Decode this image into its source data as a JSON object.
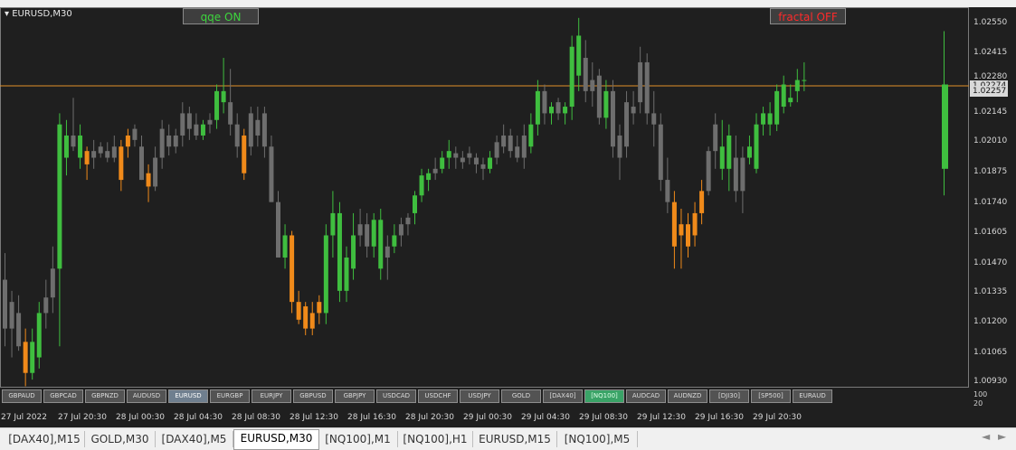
{
  "window": {
    "title": "EURUSD,M30"
  },
  "toggles": {
    "qqe": "qqe ON",
    "fractal": "fractal OFF"
  },
  "colors": {
    "up": "#3fbe3f",
    "down": "#f08a1a",
    "neutral": "#6e6e6e",
    "price_line": "#e0902a",
    "qqe_text": "#3dd63d",
    "fractal_text": "#ff2a2a"
  },
  "price_axis": {
    "labels": [
      "1.02550",
      "1.02415",
      "1.02280",
      "1.02145",
      "1.02010",
      "1.01875",
      "1.01740",
      "1.01605",
      "1.01470",
      "1.01335",
      "1.01200",
      "1.01065",
      "1.00930"
    ],
    "current_price": "1.02257",
    "line_price": "1.02274"
  },
  "indicator_axis": {
    "labels": [
      "100",
      "20"
    ]
  },
  "time_axis": [
    "27 Jul 2022",
    "27 Jul 20:30",
    "28 Jul 00:30",
    "28 Jul 04:30",
    "28 Jul 08:30",
    "28 Jul 12:30",
    "28 Jul 16:30",
    "28 Jul 20:30",
    "29 Jul 00:30",
    "29 Jul 04:30",
    "29 Jul 08:30",
    "29 Jul 12:30",
    "29 Jul 16:30",
    "29 Jul 20:30"
  ],
  "symbol_buttons": [
    "GBPAUD",
    "GBPCAD",
    "GBPNZD",
    "AUDUSD",
    "EURUSD",
    "EURGBP",
    "EURJPY",
    "GBPUSD",
    "GBPJPY",
    "USDCAD",
    "USDCHF",
    "USDJPY",
    "GOLD",
    "[DAX40]",
    "[NQ100]",
    "AUDCAD",
    "AUDNZD",
    "[DJI30]",
    "[SP500]",
    "EURAUD"
  ],
  "active_symbol": "EURUSD",
  "highlight_symbol": "[NQ100]",
  "tabs": [
    "[DAX40],M15",
    "GOLD,M30",
    "[DAX40],M5",
    "EURUSD,M30",
    "[NQ100],M1",
    "[NQ100],H1",
    "EURUSD,M15",
    "[NQ100],M5"
  ],
  "active_tab": "EURUSD,M30",
  "tab_nav": {
    "left": "◄",
    "right": "►"
  },
  "chart_data": {
    "type": "candlestick",
    "symbol": "EURUSD",
    "timeframe": "M30",
    "ylim": [
      1.0093,
      1.0262
    ],
    "candles": [
      {
        "o": 1.014,
        "h": 1.0152,
        "l": 1.011,
        "c": 1.0118,
        "k": "n"
      },
      {
        "o": 1.0118,
        "h": 1.0135,
        "l": 1.0105,
        "c": 1.013,
        "k": "n"
      },
      {
        "o": 1.0125,
        "h": 1.0133,
        "l": 1.0108,
        "c": 1.011,
        "k": "n"
      },
      {
        "o": 1.0112,
        "h": 1.0118,
        "l": 1.0092,
        "c": 1.0098,
        "k": "d"
      },
      {
        "o": 1.0098,
        "h": 1.0118,
        "l": 1.0095,
        "c": 1.0112,
        "k": "u"
      },
      {
        "o": 1.0105,
        "h": 1.013,
        "l": 1.01,
        "c": 1.0125,
        "k": "u"
      },
      {
        "o": 1.0125,
        "h": 1.014,
        "l": 1.0118,
        "c": 1.0132,
        "k": "n"
      },
      {
        "o": 1.0132,
        "h": 1.0155,
        "l": 1.0125,
        "c": 1.0145,
        "k": "n"
      },
      {
        "o": 1.0145,
        "h": 1.0215,
        "l": 1.011,
        "c": 1.021,
        "k": "u"
      },
      {
        "o": 1.0195,
        "h": 1.0212,
        "l": 1.0187,
        "c": 1.0205,
        "k": "u"
      },
      {
        "o": 1.0205,
        "h": 1.0222,
        "l": 1.0198,
        "c": 1.02,
        "k": "n"
      },
      {
        "o": 1.0205,
        "h": 1.021,
        "l": 1.019,
        "c": 1.0195,
        "k": "u"
      },
      {
        "o": 1.0198,
        "h": 1.02,
        "l": 1.0185,
        "c": 1.0192,
        "k": "d"
      },
      {
        "o": 1.0198,
        "h": 1.0203,
        "l": 1.019,
        "c": 1.0195,
        "k": "n"
      },
      {
        "o": 1.02,
        "h": 1.0202,
        "l": 1.0195,
        "c": 1.0197,
        "k": "n"
      },
      {
        "o": 1.0198,
        "h": 1.0202,
        "l": 1.0193,
        "c": 1.0195,
        "k": "n"
      },
      {
        "o": 1.02,
        "h": 1.0205,
        "l": 1.0193,
        "c": 1.0195,
        "k": "n"
      },
      {
        "o": 1.02,
        "h": 1.0203,
        "l": 1.018,
        "c": 1.0185,
        "k": "d"
      },
      {
        "o": 1.02,
        "h": 1.0208,
        "l": 1.0195,
        "c": 1.0205,
        "k": "d"
      },
      {
        "o": 1.0208,
        "h": 1.021,
        "l": 1.02,
        "c": 1.0203,
        "k": "n"
      },
      {
        "o": 1.02,
        "h": 1.0205,
        "l": 1.0185,
        "c": 1.0185,
        "k": "n"
      },
      {
        "o": 1.0188,
        "h": 1.0192,
        "l": 1.0175,
        "c": 1.0182,
        "k": "d"
      },
      {
        "o": 1.0182,
        "h": 1.02,
        "l": 1.018,
        "c": 1.0195,
        "k": "n"
      },
      {
        "o": 1.0195,
        "h": 1.0212,
        "l": 1.019,
        "c": 1.0208,
        "k": "n"
      },
      {
        "o": 1.0205,
        "h": 1.021,
        "l": 1.0196,
        "c": 1.02,
        "k": "n"
      },
      {
        "o": 1.02,
        "h": 1.0208,
        "l": 1.0197,
        "c": 1.0205,
        "k": "n"
      },
      {
        "o": 1.0205,
        "h": 1.022,
        "l": 1.02,
        "c": 1.0215,
        "k": "n"
      },
      {
        "o": 1.0215,
        "h": 1.0218,
        "l": 1.0203,
        "c": 1.0208,
        "k": "n"
      },
      {
        "o": 1.021,
        "h": 1.0215,
        "l": 1.0203,
        "c": 1.0205,
        "k": "n"
      },
      {
        "o": 1.0205,
        "h": 1.0212,
        "l": 1.0203,
        "c": 1.021,
        "k": "u"
      },
      {
        "o": 1.021,
        "h": 1.0215,
        "l": 1.0206,
        "c": 1.0212,
        "k": "n"
      },
      {
        "o": 1.0212,
        "h": 1.0228,
        "l": 1.0208,
        "c": 1.0225,
        "k": "u"
      },
      {
        "o": 1.0225,
        "h": 1.024,
        "l": 1.0215,
        "c": 1.022,
        "k": "u"
      },
      {
        "o": 1.022,
        "h": 1.0235,
        "l": 1.0205,
        "c": 1.021,
        "k": "n"
      },
      {
        "o": 1.021,
        "h": 1.0215,
        "l": 1.0195,
        "c": 1.02,
        "k": "n"
      },
      {
        "o": 1.0205,
        "h": 1.0208,
        "l": 1.0185,
        "c": 1.0188,
        "k": "d"
      },
      {
        "o": 1.02,
        "h": 1.0218,
        "l": 1.0196,
        "c": 1.0215,
        "k": "n"
      },
      {
        "o": 1.0212,
        "h": 1.0218,
        "l": 1.02,
        "c": 1.0205,
        "k": "n"
      },
      {
        "o": 1.0215,
        "h": 1.0218,
        "l": 1.0195,
        "c": 1.02,
        "k": "n"
      },
      {
        "o": 1.02,
        "h": 1.0205,
        "l": 1.0175,
        "c": 1.0175,
        "k": "n"
      },
      {
        "o": 1.0175,
        "h": 1.018,
        "l": 1.015,
        "c": 1.015,
        "k": "n"
      },
      {
        "o": 1.015,
        "h": 1.0165,
        "l": 1.0145,
        "c": 1.016,
        "k": "u"
      },
      {
        "o": 1.016,
        "h": 1.0162,
        "l": 1.0125,
        "c": 1.013,
        "k": "d"
      },
      {
        "o": 1.013,
        "h": 1.0135,
        "l": 1.012,
        "c": 1.0122,
        "k": "d"
      },
      {
        "o": 1.0128,
        "h": 1.013,
        "l": 1.0115,
        "c": 1.0118,
        "k": "d"
      },
      {
        "o": 1.0125,
        "h": 1.013,
        "l": 1.0115,
        "c": 1.0118,
        "k": "d"
      },
      {
        "o": 1.013,
        "h": 1.0133,
        "l": 1.012,
        "c": 1.0125,
        "k": "d"
      },
      {
        "o": 1.0125,
        "h": 1.0165,
        "l": 1.012,
        "c": 1.016,
        "k": "u"
      },
      {
        "o": 1.016,
        "h": 1.018,
        "l": 1.015,
        "c": 1.017,
        "k": "u"
      },
      {
        "o": 1.017,
        "h": 1.0175,
        "l": 1.013,
        "c": 1.0135,
        "k": "u"
      },
      {
        "o": 1.0135,
        "h": 1.0155,
        "l": 1.013,
        "c": 1.015,
        "k": "u"
      },
      {
        "o": 1.0145,
        "h": 1.017,
        "l": 1.014,
        "c": 1.016,
        "k": "u"
      },
      {
        "o": 1.016,
        "h": 1.0172,
        "l": 1.0155,
        "c": 1.0165,
        "k": "n"
      },
      {
        "o": 1.0165,
        "h": 1.017,
        "l": 1.015,
        "c": 1.0155,
        "k": "n"
      },
      {
        "o": 1.0155,
        "h": 1.017,
        "l": 1.015,
        "c": 1.0167,
        "k": "u"
      },
      {
        "o": 1.0167,
        "h": 1.0172,
        "l": 1.014,
        "c": 1.0145,
        "k": "u"
      },
      {
        "o": 1.0155,
        "h": 1.016,
        "l": 1.014,
        "c": 1.015,
        "k": "n"
      },
      {
        "o": 1.0155,
        "h": 1.0165,
        "l": 1.0152,
        "c": 1.016,
        "k": "u"
      },
      {
        "o": 1.016,
        "h": 1.0168,
        "l": 1.0155,
        "c": 1.0165,
        "k": "n"
      },
      {
        "o": 1.0165,
        "h": 1.017,
        "l": 1.016,
        "c": 1.0168,
        "k": "n"
      },
      {
        "o": 1.017,
        "h": 1.018,
        "l": 1.0165,
        "c": 1.0178,
        "k": "u"
      },
      {
        "o": 1.0178,
        "h": 1.019,
        "l": 1.0175,
        "c": 1.0187,
        "k": "u"
      },
      {
        "o": 1.0185,
        "h": 1.019,
        "l": 1.018,
        "c": 1.0188,
        "k": "u"
      },
      {
        "o": 1.0188,
        "h": 1.0195,
        "l": 1.0185,
        "c": 1.019,
        "k": "n"
      },
      {
        "o": 1.019,
        "h": 1.0198,
        "l": 1.0188,
        "c": 1.0195,
        "k": "u"
      },
      {
        "o": 1.0195,
        "h": 1.0203,
        "l": 1.019,
        "c": 1.0198,
        "k": "u"
      },
      {
        "o": 1.0197,
        "h": 1.02,
        "l": 1.019,
        "c": 1.0195,
        "k": "n"
      },
      {
        "o": 1.0195,
        "h": 1.0198,
        "l": 1.019,
        "c": 1.0193,
        "k": "n"
      },
      {
        "o": 1.0195,
        "h": 1.02,
        "l": 1.0192,
        "c": 1.0197,
        "k": "n"
      },
      {
        "o": 1.0195,
        "h": 1.0197,
        "l": 1.0188,
        "c": 1.0192,
        "k": "n"
      },
      {
        "o": 1.0192,
        "h": 1.0195,
        "l": 1.0185,
        "c": 1.019,
        "k": "n"
      },
      {
        "o": 1.019,
        "h": 1.0198,
        "l": 1.0188,
        "c": 1.0195,
        "k": "u"
      },
      {
        "o": 1.0195,
        "h": 1.0205,
        "l": 1.0192,
        "c": 1.0202,
        "k": "n"
      },
      {
        "o": 1.02,
        "h": 1.021,
        "l": 1.0197,
        "c": 1.0205,
        "k": "n"
      },
      {
        "o": 1.0205,
        "h": 1.0208,
        "l": 1.0195,
        "c": 1.0198,
        "k": "n"
      },
      {
        "o": 1.02,
        "h": 1.0205,
        "l": 1.0193,
        "c": 1.0195,
        "k": "n"
      },
      {
        "o": 1.0195,
        "h": 1.021,
        "l": 1.019,
        "c": 1.0205,
        "k": "n"
      },
      {
        "o": 1.02,
        "h": 1.0215,
        "l": 1.0197,
        "c": 1.021,
        "k": "u"
      },
      {
        "o": 1.021,
        "h": 1.023,
        "l": 1.0205,
        "c": 1.0225,
        "k": "u"
      },
      {
        "o": 1.0225,
        "h": 1.0228,
        "l": 1.021,
        "c": 1.0215,
        "k": "n"
      },
      {
        "o": 1.0215,
        "h": 1.022,
        "l": 1.021,
        "c": 1.0218,
        "k": "u"
      },
      {
        "o": 1.022,
        "h": 1.0222,
        "l": 1.0212,
        "c": 1.0215,
        "k": "n"
      },
      {
        "o": 1.0215,
        "h": 1.022,
        "l": 1.021,
        "c": 1.0218,
        "k": "u"
      },
      {
        "o": 1.0218,
        "h": 1.025,
        "l": 1.0212,
        "c": 1.0245,
        "k": "u"
      },
      {
        "o": 1.025,
        "h": 1.0258,
        "l": 1.0225,
        "c": 1.0232,
        "k": "u"
      },
      {
        "o": 1.024,
        "h": 1.0248,
        "l": 1.022,
        "c": 1.0225,
        "k": "n"
      },
      {
        "o": 1.023,
        "h": 1.0238,
        "l": 1.0218,
        "c": 1.0225,
        "k": "n"
      },
      {
        "o": 1.0232,
        "h": 1.0235,
        "l": 1.021,
        "c": 1.0213,
        "k": "n"
      },
      {
        "o": 1.0213,
        "h": 1.023,
        "l": 1.0208,
        "c": 1.0225,
        "k": "u"
      },
      {
        "o": 1.0225,
        "h": 1.023,
        "l": 1.0195,
        "c": 1.02,
        "k": "n"
      },
      {
        "o": 1.0205,
        "h": 1.021,
        "l": 1.0185,
        "c": 1.0195,
        "k": "n"
      },
      {
        "o": 1.02,
        "h": 1.0225,
        "l": 1.0195,
        "c": 1.022,
        "k": "n"
      },
      {
        "o": 1.0215,
        "h": 1.0225,
        "l": 1.021,
        "c": 1.0218,
        "k": "n"
      },
      {
        "o": 1.022,
        "h": 1.0245,
        "l": 1.0215,
        "c": 1.0238,
        "k": "n"
      },
      {
        "o": 1.0238,
        "h": 1.0242,
        "l": 1.021,
        "c": 1.0215,
        "k": "n"
      },
      {
        "o": 1.0215,
        "h": 1.0225,
        "l": 1.02,
        "c": 1.021,
        "k": "n"
      },
      {
        "o": 1.021,
        "h": 1.0215,
        "l": 1.018,
        "c": 1.0185,
        "k": "n"
      },
      {
        "o": 1.0185,
        "h": 1.0195,
        "l": 1.017,
        "c": 1.0175,
        "k": "n"
      },
      {
        "o": 1.0175,
        "h": 1.018,
        "l": 1.0145,
        "c": 1.0155,
        "k": "d"
      },
      {
        "o": 1.016,
        "h": 1.0172,
        "l": 1.0145,
        "c": 1.0165,
        "k": "d"
      },
      {
        "o": 1.0165,
        "h": 1.017,
        "l": 1.015,
        "c": 1.0155,
        "k": "d"
      },
      {
        "o": 1.016,
        "h": 1.0175,
        "l": 1.0155,
        "c": 1.017,
        "k": "d"
      },
      {
        "o": 1.017,
        "h": 1.0185,
        "l": 1.0165,
        "c": 1.018,
        "k": "d"
      },
      {
        "o": 1.018,
        "h": 1.02,
        "l": 1.0178,
        "c": 1.0198,
        "k": "n"
      },
      {
        "o": 1.0198,
        "h": 1.0215,
        "l": 1.019,
        "c": 1.021,
        "k": "n"
      },
      {
        "o": 1.02,
        "h": 1.0212,
        "l": 1.0185,
        "c": 1.019,
        "k": "u"
      },
      {
        "o": 1.019,
        "h": 1.021,
        "l": 1.018,
        "c": 1.0205,
        "k": "u"
      },
      {
        "o": 1.0195,
        "h": 1.0205,
        "l": 1.0175,
        "c": 1.018,
        "k": "n"
      },
      {
        "o": 1.018,
        "h": 1.02,
        "l": 1.017,
        "c": 1.0195,
        "k": "n"
      },
      {
        "o": 1.0195,
        "h": 1.0205,
        "l": 1.0192,
        "c": 1.02,
        "k": "u"
      },
      {
        "o": 1.019,
        "h": 1.0215,
        "l": 1.0188,
        "c": 1.021,
        "k": "u"
      },
      {
        "o": 1.021,
        "h": 1.0218,
        "l": 1.0205,
        "c": 1.0215,
        "k": "u"
      },
      {
        "o": 1.0215,
        "h": 1.022,
        "l": 1.0205,
        "c": 1.021,
        "k": "u"
      },
      {
        "o": 1.021,
        "h": 1.0228,
        "l": 1.0207,
        "c": 1.0225,
        "k": "u"
      },
      {
        "o": 1.0218,
        "h": 1.0232,
        "l": 1.0215,
        "c": 1.0228,
        "k": "u"
      },
      {
        "o": 1.0222,
        "h": 1.0228,
        "l": 1.0218,
        "c": 1.022,
        "k": "u"
      },
      {
        "o": 1.0225,
        "h": 1.0235,
        "l": 1.022,
        "c": 1.023,
        "k": "u"
      },
      {
        "o": 1.023,
        "h": 1.0238,
        "l": 1.0225,
        "c": 1.023,
        "k": "u"
      },
      {
        "o": 1.0228,
        "h": 1.0252,
        "l": 1.0178,
        "c": 1.019,
        "k": "u",
        "detached": true
      }
    ]
  }
}
